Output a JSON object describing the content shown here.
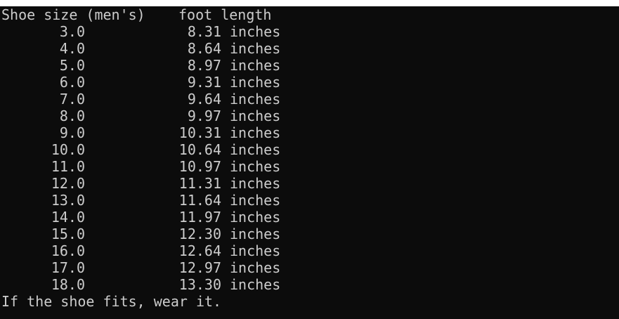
{
  "console": {
    "header": {
      "size_label": "Shoe size (men's)",
      "length_label": "foot length"
    },
    "rows": [
      {
        "size": "3.0",
        "length": "8.31",
        "unit": "inches"
      },
      {
        "size": "4.0",
        "length": "8.64",
        "unit": "inches"
      },
      {
        "size": "5.0",
        "length": "8.97",
        "unit": "inches"
      },
      {
        "size": "6.0",
        "length": "9.31",
        "unit": "inches"
      },
      {
        "size": "7.0",
        "length": "9.64",
        "unit": "inches"
      },
      {
        "size": "8.0",
        "length": "9.97",
        "unit": "inches"
      },
      {
        "size": "9.0",
        "length": "10.31",
        "unit": "inches"
      },
      {
        "size": "10.0",
        "length": "10.64",
        "unit": "inches"
      },
      {
        "size": "11.0",
        "length": "10.97",
        "unit": "inches"
      },
      {
        "size": "12.0",
        "length": "11.31",
        "unit": "inches"
      },
      {
        "size": "13.0",
        "length": "11.64",
        "unit": "inches"
      },
      {
        "size": "14.0",
        "length": "11.97",
        "unit": "inches"
      },
      {
        "size": "15.0",
        "length": "12.30",
        "unit": "inches"
      },
      {
        "size": "16.0",
        "length": "12.64",
        "unit": "inches"
      },
      {
        "size": "17.0",
        "length": "12.97",
        "unit": "inches"
      },
      {
        "size": "18.0",
        "length": "13.30",
        "unit": "inches"
      }
    ],
    "footer": "If the shoe fits, wear it."
  },
  "colors": {
    "background": "#0c0c0c",
    "text": "#cccccc"
  }
}
